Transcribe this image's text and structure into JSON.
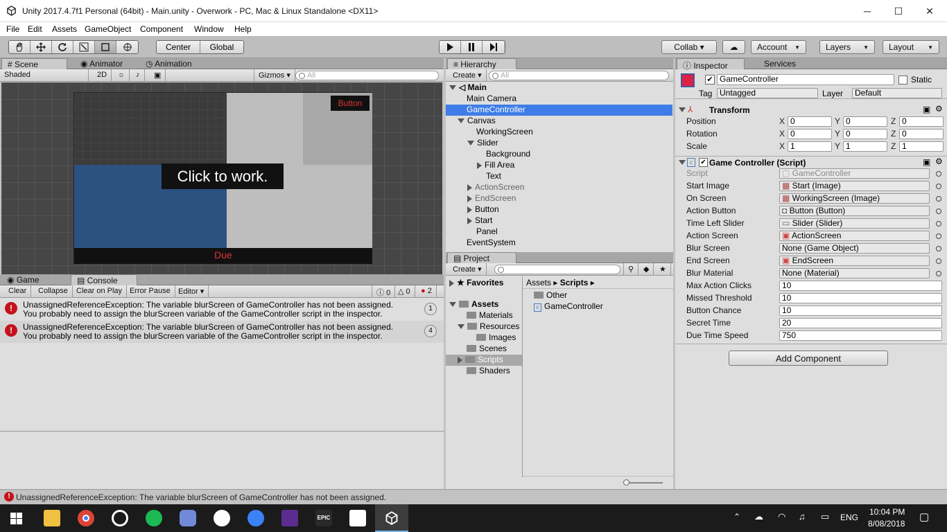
{
  "window": {
    "title": "Unity 2017.4.7f1 Personal (64bit) - Main.unity - Overwork - PC, Mac & Linux Standalone <DX11>",
    "min": "─",
    "max": "☐",
    "close": "✕"
  },
  "menu": [
    "File",
    "Edit",
    "Assets",
    "GameObject",
    "Component",
    "Window",
    "Help"
  ],
  "toolbar": {
    "center": "Center",
    "global": "Global",
    "collab": "Collab ▾",
    "account": "Account",
    "layers": "Layers",
    "layout": "Layout"
  },
  "scene": {
    "tabs": [
      "# Scene",
      "Animator",
      "Animation"
    ],
    "shaded": "Shaded",
    "mode2d": "2D",
    "gizmos": "Gizmos ▾",
    "search_placeholder": "All",
    "overlay_text": "Click to work.",
    "button_text": "Button",
    "due_text": "Due"
  },
  "console": {
    "tabs": [
      "Game",
      "Console"
    ],
    "buttons": [
      "Clear",
      "Collapse",
      "Clear on Play",
      "Error Pause",
      "Editor ▾"
    ],
    "info_count": "0",
    "warn_count": "0",
    "err_count": "2",
    "messages": [
      {
        "line1": "UnassignedReferenceException: The variable blurScreen of GameController has not been assigned.",
        "line2": "You probably need to assign the blurScreen variable of the GameController script in the inspector.",
        "count": "1"
      },
      {
        "line1": "UnassignedReferenceException: The variable blurScreen of GameController has not been assigned.",
        "line2": "You probably need to assign the blurScreen variable of the GameController script in the inspector.",
        "count": "4"
      }
    ]
  },
  "hierarchy": {
    "tab": "Hierarchy",
    "create": "Create ▾",
    "search_placeholder": "All",
    "scene": "Main",
    "items": [
      "Main Camera",
      "GameController",
      "Canvas",
      "WorkingScreen",
      "Slider",
      "Background",
      "Fill Area",
      "Text",
      "ActionScreen",
      "EndScreen",
      "Button",
      "Start",
      "Panel",
      "EventSystem"
    ]
  },
  "project": {
    "tab": "Project",
    "create": "Create ▾",
    "favorites": "Favorites",
    "assets": "Assets",
    "tree": [
      "Materials",
      "Resources",
      "Images",
      "Scenes",
      "Scripts",
      "Shaders"
    ],
    "breadcrumb": [
      "Assets",
      "Scripts"
    ],
    "files": [
      "Other",
      "GameController"
    ]
  },
  "inspector": {
    "tabs": [
      "Inspector",
      "Services"
    ],
    "name": "GameController",
    "static": "Static",
    "tag_label": "Tag",
    "tag": "Untagged",
    "layer_label": "Layer",
    "layer": "Default",
    "transform": {
      "title": "Transform",
      "rows": [
        {
          "label": "Position",
          "x": "0",
          "y": "0",
          "z": "0"
        },
        {
          "label": "Rotation",
          "x": "0",
          "y": "0",
          "z": "0"
        },
        {
          "label": "Scale",
          "x": "1",
          "y": "1",
          "z": "1"
        }
      ]
    },
    "script": {
      "title": "Game Controller (Script)",
      "rows": [
        {
          "label": "Script",
          "value": "GameController"
        },
        {
          "label": "Start Image",
          "value": "Start (Image)"
        },
        {
          "label": "On Screen",
          "value": "WorkingScreen (Image)"
        },
        {
          "label": "Action Button",
          "value": "Button (Button)"
        },
        {
          "label": "Time Left Slider",
          "value": "Slider (Slider)"
        },
        {
          "label": "Action Screen",
          "value": "ActionScreen"
        },
        {
          "label": "Blur Screen",
          "value": "None (Game Object)"
        },
        {
          "label": "End Screen",
          "value": "EndScreen"
        },
        {
          "label": "Blur Material",
          "value": "None (Material)"
        },
        {
          "label": "Max Action Clicks",
          "value": "10"
        },
        {
          "label": "Missed Threshold",
          "value": "10"
        },
        {
          "label": "Button Chance",
          "value": "10"
        },
        {
          "label": "Secret Time",
          "value": "20"
        },
        {
          "label": "Due Time Speed",
          "value": "750"
        }
      ]
    },
    "add_component": "Add Component"
  },
  "statusbar": "UnassignedReferenceException: The variable blurScreen of GameController has not been assigned.",
  "taskbar": {
    "lang": "ENG",
    "time": "10:04 PM",
    "date": "8/08/2018",
    "epic": "EPIC"
  }
}
